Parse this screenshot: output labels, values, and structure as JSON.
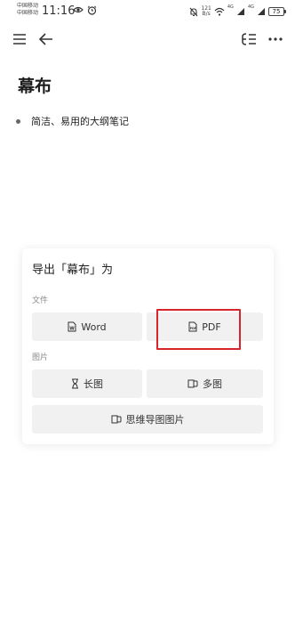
{
  "status_bar": {
    "carrier_1": "中国移动",
    "carrier_2": "中国移动",
    "time": "11:16",
    "net_speed_value": "121",
    "net_speed_unit": "B/s",
    "signal_1": "4G",
    "signal_2": "4G",
    "battery": "75"
  },
  "toolbar": {
    "menu_icon": "hamburger-menu-icon",
    "back_icon": "arrow-left-icon",
    "outline_icon": "outline-view-icon",
    "more_icon": "more-horizontal-icon"
  },
  "document": {
    "title": "幕布",
    "bullets": [
      "简洁、易用的大纲笔记"
    ]
  },
  "export_panel": {
    "title": "导出「幕布」为",
    "file_section_label": "文件",
    "image_section_label": "图片",
    "options": {
      "word": "Word",
      "pdf": "PDF",
      "long_image": "长图",
      "multi_image": "多图",
      "mindmap_image": "思维导图图片"
    }
  },
  "colors": {
    "highlight": "#d8242b",
    "button_bg": "#f1f1f1"
  }
}
